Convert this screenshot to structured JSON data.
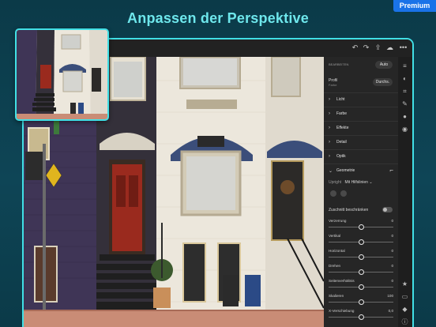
{
  "badge": {
    "label": "Premium"
  },
  "headline": "Anpassen der Perspektive",
  "toolbar": {
    "icons": [
      "undo-icon",
      "redo-icon",
      "share-icon",
      "cloud-icon",
      "more-icon"
    ]
  },
  "panel": {
    "bearbeiten_label": "BEARBEITEN",
    "auto_button": "Auto",
    "profile_label": "Profil",
    "profile_value": "Farbe",
    "browse_button": "Durchs.",
    "sections": [
      {
        "label": "Licht"
      },
      {
        "label": "Farbe"
      },
      {
        "label": "Effekte"
      },
      {
        "label": "Detail"
      },
      {
        "label": "Optik"
      }
    ],
    "geometry": {
      "label": "Geometrie",
      "upright_label": "Upright",
      "upright_value": "Mit Hilfslinien",
      "constrain_label": "Zuschnitt beschränken",
      "constrain_on": false,
      "sliders": [
        {
          "name": "Verzerrung",
          "value": "0",
          "level": 0.5
        },
        {
          "name": "Vertikal",
          "value": "0",
          "level": 0.5
        },
        {
          "name": "Horizontal",
          "value": "0",
          "level": 0.5
        },
        {
          "name": "Drehen",
          "value": "0",
          "level": 0.5
        },
        {
          "name": "Seitenverhältnis",
          "value": "0",
          "level": 0.5
        },
        {
          "name": "Skalieren",
          "value": "100",
          "level": 0.5
        },
        {
          "name": "X-Verschiebung",
          "value": "0,0",
          "level": 0.5
        }
      ]
    }
  },
  "sidebar_icons": [
    "sliders-icon",
    "presets-icon",
    "crop-icon",
    "healing-icon",
    "masking-icon",
    "redeye-icon",
    "star-icon",
    "comment-icon",
    "tag-icon",
    "info-icon"
  ],
  "colors": {
    "accent": "#41e0e6",
    "headline": "#6ee7ec",
    "premium": "#1a73e8",
    "door_red": "#9a2a1e",
    "brick_purple": "#3f3556"
  }
}
